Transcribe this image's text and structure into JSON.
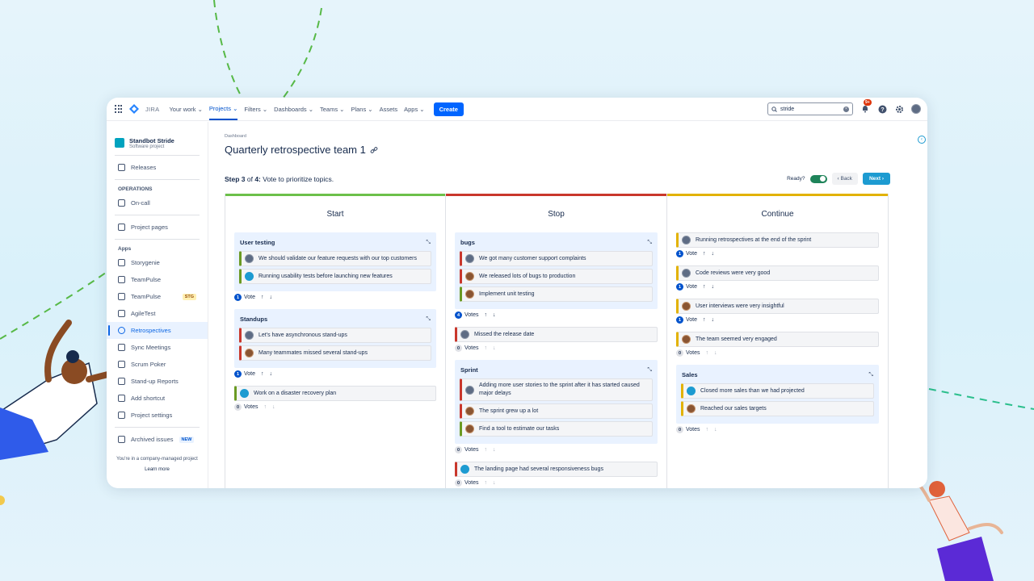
{
  "app": {
    "brand": "JIRA"
  },
  "nav": {
    "items": [
      {
        "label": "Your work ⌄",
        "active": false
      },
      {
        "label": "Projects ⌄",
        "active": true
      },
      {
        "label": "Filters ⌄",
        "active": false
      },
      {
        "label": "Dashboards ⌄",
        "active": false
      },
      {
        "label": "Teams ⌄",
        "active": false
      },
      {
        "label": "Plans ⌄",
        "active": false
      },
      {
        "label": "Assets",
        "active": false
      },
      {
        "label": "Apps ⌄",
        "active": false
      }
    ],
    "create_label": "Create",
    "search_value": "stride",
    "notifications_badge": "9+"
  },
  "sidebar": {
    "project_name": "Standbot Stride",
    "project_type": "Software project",
    "releases": "Releases",
    "operations_heading": "OPERATIONS",
    "oncall": "On-call",
    "project_pages": "Project pages",
    "apps_heading": "Apps",
    "apps": [
      {
        "label": "Storygenie"
      },
      {
        "label": "TeamPulse"
      },
      {
        "label": "TeamPulse",
        "tag": "STG"
      },
      {
        "label": "AgileTest"
      },
      {
        "label": "Retrospectives",
        "active": true
      },
      {
        "label": "Sync Meetings"
      },
      {
        "label": "Scrum Poker"
      },
      {
        "label": "Stand-up Reports"
      },
      {
        "label": "Add shortcut"
      },
      {
        "label": "Project settings"
      }
    ],
    "archived": "Archived issues",
    "archived_tag": "NEW",
    "footer_text": "You're in a company-managed project",
    "learn_more": "Learn more"
  },
  "main": {
    "breadcrumb": "Dashboard",
    "title": "Quarterly retrospective team 1",
    "step_bold": "Step 3",
    "step_of": " of ",
    "step_total": "4:",
    "step_desc": " Vote to prioritize topics.",
    "ready_label": "Ready?",
    "back_label": "‹  Back",
    "next_label": "Next  ›"
  },
  "columns": [
    {
      "title": "Start",
      "color": "#6cc04a",
      "groups": [
        {
          "title": "User testing",
          "votes": "1",
          "vote_label": "Vote",
          "active": true,
          "cards": [
            {
              "text": "We should validate our feature requests with our top customers",
              "color": "green",
              "av": "a"
            },
            {
              "text": "Running usability tests before launching new features",
              "color": "green",
              "av": "c"
            }
          ]
        },
        {
          "title": "Standups",
          "votes": "1",
          "vote_label": "Vote",
          "active": true,
          "cards": [
            {
              "text": "Let's have asynchronous stand-ups",
              "color": "red",
              "av": "a"
            },
            {
              "text": "Many teammates missed several stand-ups",
              "color": "red",
              "av": "b"
            }
          ]
        }
      ],
      "loose": [
        {
          "text": "Work on a disaster recovery plan",
          "color": "green",
          "av": "c",
          "votes": "0",
          "vote_label": "Votes",
          "active": false
        }
      ]
    },
    {
      "title": "Stop",
      "color": "#c9372c",
      "groups": [
        {
          "title": "bugs",
          "votes": "4",
          "vote_label": "Votes",
          "active": true,
          "cards": [
            {
              "text": "We got many customer support complaints",
              "color": "red",
              "av": "a"
            },
            {
              "text": "We released lots of bugs to production",
              "color": "red",
              "av": "b"
            },
            {
              "text": "Implement unit testing",
              "color": "green",
              "av": "b"
            }
          ]
        }
      ],
      "loose_mid": [
        {
          "text": "Missed the release date",
          "color": "red",
          "av": "a",
          "votes": "0",
          "vote_label": "Votes",
          "active": false
        }
      ],
      "groups2": [
        {
          "title": "Sprint",
          "votes": "0",
          "vote_label": "Votes",
          "active": false,
          "cards": [
            {
              "text": "Adding more user stories to the sprint after it has started caused major delays",
              "color": "red",
              "av": "a"
            },
            {
              "text": "The sprint grew up a lot",
              "color": "red",
              "av": "b"
            },
            {
              "text": "Find a tool to estimate our tasks",
              "color": "green",
              "av": "b"
            }
          ]
        }
      ],
      "loose": [
        {
          "text": "The landing page had several responsiveness bugs",
          "color": "red",
          "av": "c",
          "votes": "0",
          "vote_label": "Votes",
          "active": false
        }
      ]
    },
    {
      "title": "Continue",
      "color": "#e2b203",
      "loose_top": [
        {
          "text": "Running retrospectives at the end of the sprint",
          "color": "yellow",
          "av": "a",
          "votes": "1",
          "vote_label": "Vote",
          "active": true
        },
        {
          "text": "Code reviews were very good",
          "color": "yellow",
          "av": "a",
          "votes": "1",
          "vote_label": "Vote",
          "active": true
        },
        {
          "text": "User interviews were very insightful",
          "color": "yellow",
          "av": "b",
          "votes": "1",
          "vote_label": "Vote",
          "active": true
        },
        {
          "text": "The team seemed very engaged",
          "color": "yellow",
          "av": "b",
          "votes": "0",
          "vote_label": "Votes",
          "active": false
        }
      ],
      "groups": [
        {
          "title": "Sales",
          "votes": "0",
          "vote_label": "Votes",
          "active": false,
          "cards": [
            {
              "text": "Closed more sales than we had projected",
              "color": "yellow",
              "av": "c"
            },
            {
              "text": "Reached our sales targets",
              "color": "yellow",
              "av": "b"
            }
          ]
        }
      ]
    }
  ]
}
